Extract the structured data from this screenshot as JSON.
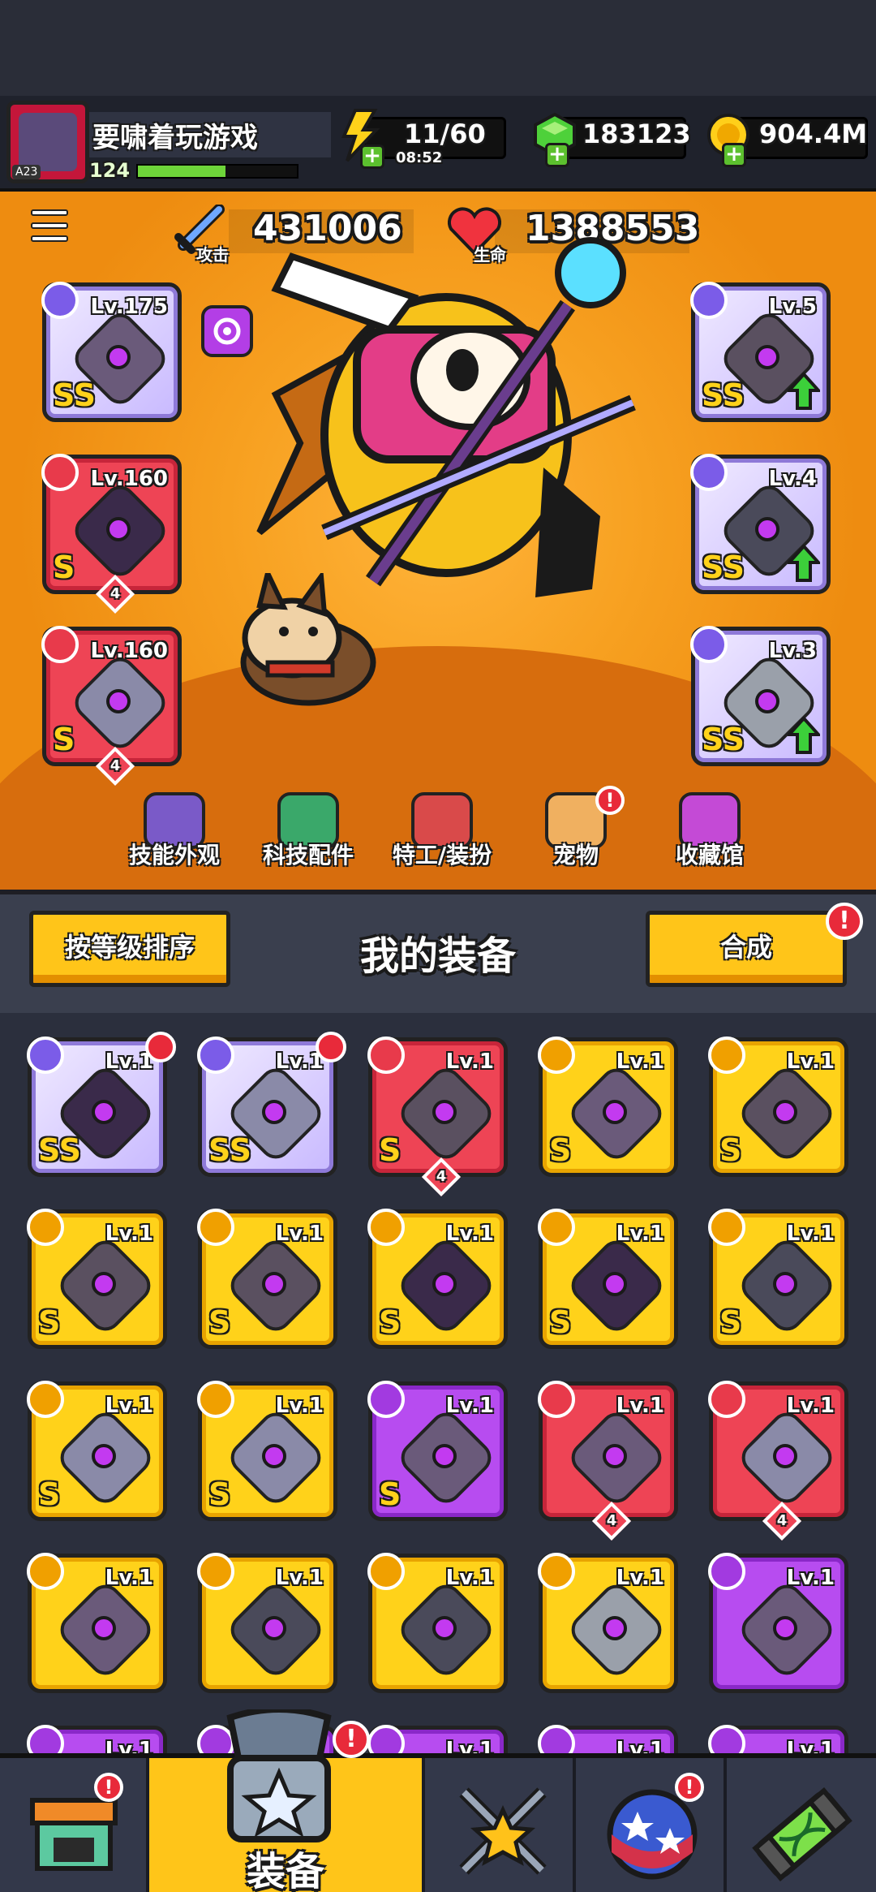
{
  "player": {
    "name": "要啸着玩游戏",
    "level": "124",
    "avatar_badge": "A23",
    "xp_fraction": 0.55
  },
  "resources": {
    "energy": "11/60",
    "energy_timer": "08:52",
    "gems": "183123",
    "coins": "904.4M"
  },
  "stats": {
    "attack_value": "431006",
    "attack_label": "攻击",
    "hp_value": "1388553",
    "hp_label": "生命"
  },
  "equipped": {
    "left": [
      {
        "level": "Lv.175",
        "rank": "SS",
        "style": "purple",
        "type": "weapon"
      },
      {
        "level": "Lv.160",
        "rank": "S",
        "style": "red",
        "type": "necklace",
        "star": "4"
      },
      {
        "level": "Lv.160",
        "rank": "S",
        "style": "red",
        "type": "glove",
        "star": "4"
      }
    ],
    "right": [
      {
        "level": "Lv.5",
        "rank": "SS",
        "style": "purple",
        "type": "armor"
      },
      {
        "level": "Lv.4",
        "rank": "SS",
        "style": "purple",
        "type": "belt"
      },
      {
        "level": "Lv.3",
        "rank": "SS",
        "style": "purple",
        "type": "boots"
      }
    ]
  },
  "menu": [
    {
      "label": "技能外观",
      "icon": "hat-ball-icon"
    },
    {
      "label": "科技配件",
      "icon": "tech-hexagon-icon"
    },
    {
      "label": "特工/装扮",
      "icon": "agent-head-icon"
    },
    {
      "label": "宠物",
      "icon": "dog-icon",
      "alert": "!"
    },
    {
      "label": "收藏馆",
      "icon": "chest-icon"
    }
  ],
  "section": {
    "sort_button": "按等级排序",
    "title": "我的装备",
    "merge_button": "合成",
    "merge_alert": "!"
  },
  "inventory": [
    {
      "level": "Lv.1",
      "rank": "SS",
      "style": "purple",
      "type": "necklace",
      "badge": true
    },
    {
      "level": "Lv.1",
      "rank": "SS",
      "style": "purple",
      "type": "glove",
      "badge": true
    },
    {
      "level": "Lv.1",
      "rank": "S",
      "style": "red",
      "type": "armor",
      "star": "4"
    },
    {
      "level": "Lv.1",
      "rank": "S",
      "style": "gold",
      "type": "weapon"
    },
    {
      "level": "Lv.1",
      "rank": "S",
      "style": "gold",
      "type": "armor"
    },
    {
      "level": "Lv.1",
      "rank": "S",
      "style": "gold",
      "type": "armor"
    },
    {
      "level": "Lv.1",
      "rank": "S",
      "style": "gold",
      "type": "armor"
    },
    {
      "level": "Lv.1",
      "rank": "S",
      "style": "gold",
      "type": "necklace"
    },
    {
      "level": "Lv.1",
      "rank": "S",
      "style": "gold",
      "type": "necklace"
    },
    {
      "level": "Lv.1",
      "rank": "S",
      "style": "gold",
      "type": "belt"
    },
    {
      "level": "Lv.1",
      "rank": "S",
      "style": "gold",
      "type": "glove"
    },
    {
      "level": "Lv.1",
      "rank": "S",
      "style": "gold",
      "type": "glove"
    },
    {
      "level": "Lv.1",
      "rank": "S",
      "style": "purple-solid",
      "type": "weapon"
    },
    {
      "level": "Lv.1",
      "rank": "",
      "style": "red",
      "type": "weapon",
      "star": "4"
    },
    {
      "level": "Lv.1",
      "rank": "",
      "style": "red",
      "type": "glove",
      "star": "4"
    },
    {
      "level": "Lv.1",
      "rank": "",
      "style": "gold",
      "type": "weapon"
    },
    {
      "level": "Lv.1",
      "rank": "",
      "style": "gold",
      "type": "belt"
    },
    {
      "level": "Lv.1",
      "rank": "",
      "style": "gold",
      "type": "belt"
    },
    {
      "level": "Lv.1",
      "rank": "",
      "style": "gold",
      "type": "boots"
    },
    {
      "level": "Lv.1",
      "rank": "",
      "style": "purple-solid",
      "type": "weapon"
    },
    {
      "level": "Lv.1",
      "rank": "",
      "style": "purple-solid",
      "type": "weapon"
    },
    {
      "level": "Lv.1",
      "rank": "",
      "style": "purple-solid",
      "type": "weapon"
    },
    {
      "level": "Lv.1",
      "rank": "",
      "style": "purple-solid",
      "type": "weapon"
    },
    {
      "level": "Lv.1",
      "rank": "",
      "style": "purple-solid",
      "type": "weapon"
    },
    {
      "level": "Lv.1",
      "rank": "",
      "style": "purple-solid",
      "type": "weapon"
    }
  ],
  "nav": {
    "shop_alert": "!",
    "active_label": "装备",
    "active_alert": "!",
    "talent_alert": "!"
  },
  "colors": {
    "hero_bg": "#f39a1a",
    "gold": "#ffd21a",
    "red": "#ee4455",
    "purple": "#b74cf0",
    "green": "#5cc02e"
  }
}
